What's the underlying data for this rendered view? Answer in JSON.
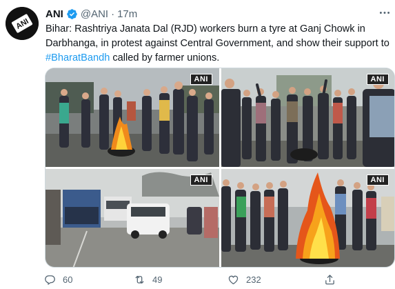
{
  "tweet": {
    "display_name": "ANI",
    "handle": "@ANI",
    "separator": "·",
    "time": "17m",
    "text_main": "Bihar: Rashtriya Janata Dal (RJD) workers burn a tyre at Ganj Chowk in Darbhanga, in protest against Central Government, and show their support to ",
    "hashtag": "#BharatBandh",
    "text_tail": " called by farmer unions.",
    "avatar_label": "ANI"
  },
  "media": {
    "watermark_text": "ANI"
  },
  "actions": {
    "reply_count": "60",
    "retweet_count": "49",
    "like_count": "232"
  },
  "colors": {
    "accent": "#1d9bf0",
    "text": "#0f1419",
    "muted": "#536471"
  },
  "icons": [
    "verified-badge-icon",
    "more-options-icon",
    "reply-icon",
    "retweet-icon",
    "like-icon",
    "share-icon"
  ]
}
